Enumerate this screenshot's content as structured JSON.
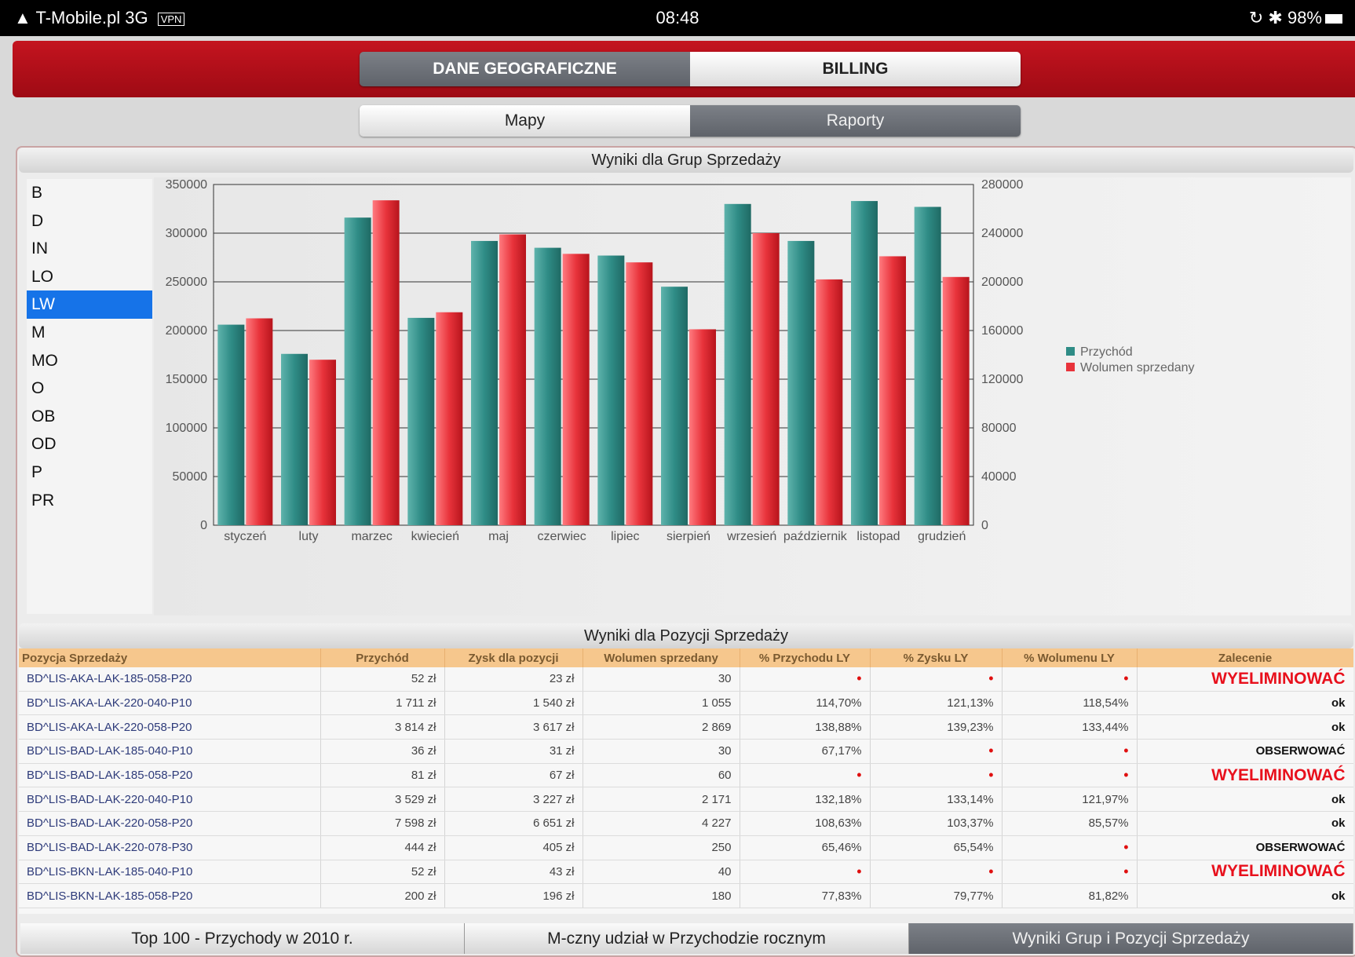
{
  "status": {
    "carrier": "T-Mobile.pl",
    "network": "3G",
    "vpn": "VPN",
    "time": "08:48",
    "battery": "98%"
  },
  "top_tabs": [
    {
      "label": "DANE GEOGRAFICZNE",
      "active": true
    },
    {
      "label": "BILLING",
      "active": false
    }
  ],
  "sub_tabs": [
    {
      "label": "Mapy",
      "active": false
    },
    {
      "label": "Raporty",
      "active": true
    }
  ],
  "groups_section": {
    "title": "Wyniki dla Grup Sprzedaży"
  },
  "groups": [
    "B",
    "D",
    "IN",
    "LO",
    "LW",
    "M",
    "MO",
    "O",
    "OB",
    "OD",
    "P",
    "PR"
  ],
  "selected_group": "LW",
  "chart_data": {
    "type": "bar",
    "categories": [
      "styczeń",
      "luty",
      "marzec",
      "kwiecień",
      "maj",
      "czerwiec",
      "lipiec",
      "sierpień",
      "wrzesień",
      "październik",
      "listopad",
      "grudzień"
    ],
    "series": [
      {
        "name": "Przychód",
        "axis": "left",
        "color": "#2f8c86",
        "values": [
          206000,
          176000,
          316000,
          213000,
          292000,
          285000,
          277000,
          245000,
          330000,
          292000,
          333000,
          327000
        ]
      },
      {
        "name": "Wolumen sprzedany",
        "axis": "right",
        "color": "#e8333b",
        "values": [
          170000,
          136000,
          267000,
          175000,
          239000,
          223000,
          216000,
          161000,
          240000,
          202000,
          221000,
          204000
        ]
      }
    ],
    "ylim_left": [
      0,
      350000
    ],
    "ylim_right": [
      0,
      280000
    ],
    "yticks_left": [
      "0",
      "50000",
      "100000",
      "150000",
      "200000",
      "250000",
      "300000",
      "350000"
    ],
    "yticks_right": [
      "0",
      "40000",
      "80000",
      "120000",
      "160000",
      "200000",
      "240000",
      "280000"
    ],
    "grid": true,
    "legend": "right"
  },
  "items_section": {
    "title": "Wyniki dla Pozycji Sprzedaży"
  },
  "table": {
    "columns": [
      "Pozycja Sprzedaży",
      "Przychód",
      "Zysk dla pozycji",
      "Wolumen sprzedany",
      "% Przychodu LY",
      "% Zysku LY",
      "% Wolumenu LY",
      "Zalecenie"
    ],
    "rows": [
      [
        "BD^LIS-AKA-LAK-185-058-P20",
        "52 zł",
        "23 zł",
        "30",
        "•",
        "•",
        "•",
        "WYELIMINOWAĆ"
      ],
      [
        "BD^LIS-AKA-LAK-220-040-P10",
        "1 711 zł",
        "1 540 zł",
        "1 055",
        "114,70%",
        "121,13%",
        "118,54%",
        "ok"
      ],
      [
        "BD^LIS-AKA-LAK-220-058-P20",
        "3 814 zł",
        "3 617 zł",
        "2 869",
        "138,88%",
        "139,23%",
        "133,44%",
        "ok"
      ],
      [
        "BD^LIS-BAD-LAK-185-040-P10",
        "36 zł",
        "31 zł",
        "30",
        "67,17%",
        "•",
        "•",
        "OBSERWOWAĆ"
      ],
      [
        "BD^LIS-BAD-LAK-185-058-P20",
        "81 zł",
        "67 zł",
        "60",
        "•",
        "•",
        "•",
        "WYELIMINOWAĆ"
      ],
      [
        "BD^LIS-BAD-LAK-220-040-P10",
        "3 529 zł",
        "3 227 zł",
        "2 171",
        "132,18%",
        "133,14%",
        "121,97%",
        "ok"
      ],
      [
        "BD^LIS-BAD-LAK-220-058-P20",
        "7 598 zł",
        "6 651 zł",
        "4 227",
        "108,63%",
        "103,37%",
        "85,57%",
        "ok"
      ],
      [
        "BD^LIS-BAD-LAK-220-078-P30",
        "444 zł",
        "405 zł",
        "250",
        "65,46%",
        "65,54%",
        "•",
        "OBSERWOWAĆ"
      ],
      [
        "BD^LIS-BKN-LAK-185-040-P10",
        "52 zł",
        "43 zł",
        "40",
        "•",
        "•",
        "•",
        "WYELIMINOWAĆ"
      ],
      [
        "BD^LIS-BKN-LAK-185-058-P20",
        "200 zł",
        "196 zł",
        "180",
        "77,83%",
        "79,77%",
        "81,82%",
        "ok"
      ]
    ]
  },
  "bottom_tabs": [
    {
      "label": "Top 100 - Przychody w 2010 r.",
      "active": false
    },
    {
      "label": "M-czny udział w Przychodzie rocznym",
      "active": false
    },
    {
      "label": "Wyniki Grup i Pozycji Sprzedaży",
      "active": true
    }
  ]
}
